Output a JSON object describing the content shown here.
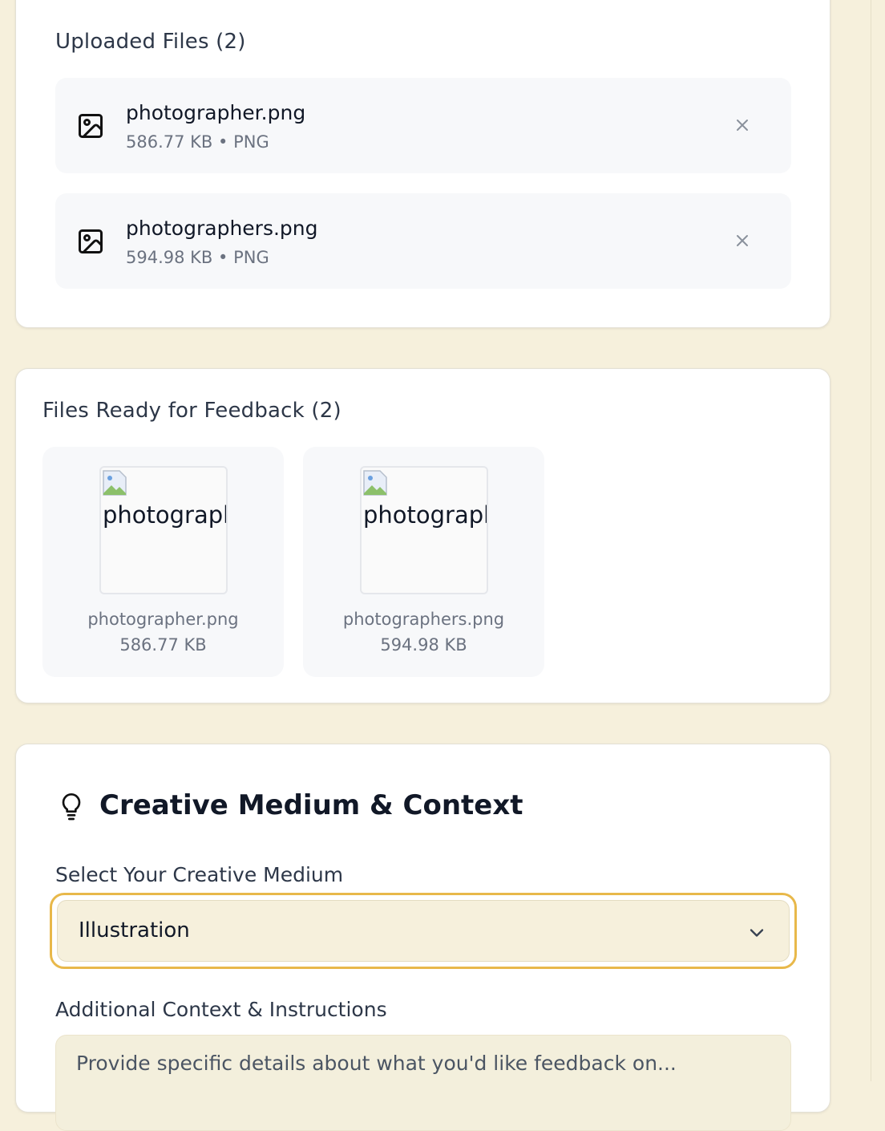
{
  "uploaded": {
    "title": "Uploaded Files (2)",
    "files": [
      {
        "name": "photographer.png",
        "meta": "586.77 KB • PNG"
      },
      {
        "name": "photographers.png",
        "meta": "594.98 KB • PNG"
      }
    ]
  },
  "ready": {
    "title": "Files Ready for Feedback (2)",
    "files": [
      {
        "alt": "photographer.png",
        "name": "photographer.png",
        "size": "586.77 KB"
      },
      {
        "alt": "photographers.png",
        "name": "photographers.png",
        "size": "594.98 KB"
      }
    ]
  },
  "medium": {
    "title": "Creative Medium & Context",
    "select_label": "Select Your Creative Medium",
    "select_value": "Illustration",
    "context_label": "Additional Context & Instructions",
    "context_placeholder": "Provide specific details about what you'd like feedback on..."
  },
  "colors": {
    "page_bg": "#f6f0dc",
    "accent_border": "#e8b84a",
    "muted_text": "#6b7280"
  },
  "icons": [
    "image-icon",
    "close-icon",
    "broken-image-icon",
    "lightbulb-icon",
    "chevron-down-icon"
  ]
}
